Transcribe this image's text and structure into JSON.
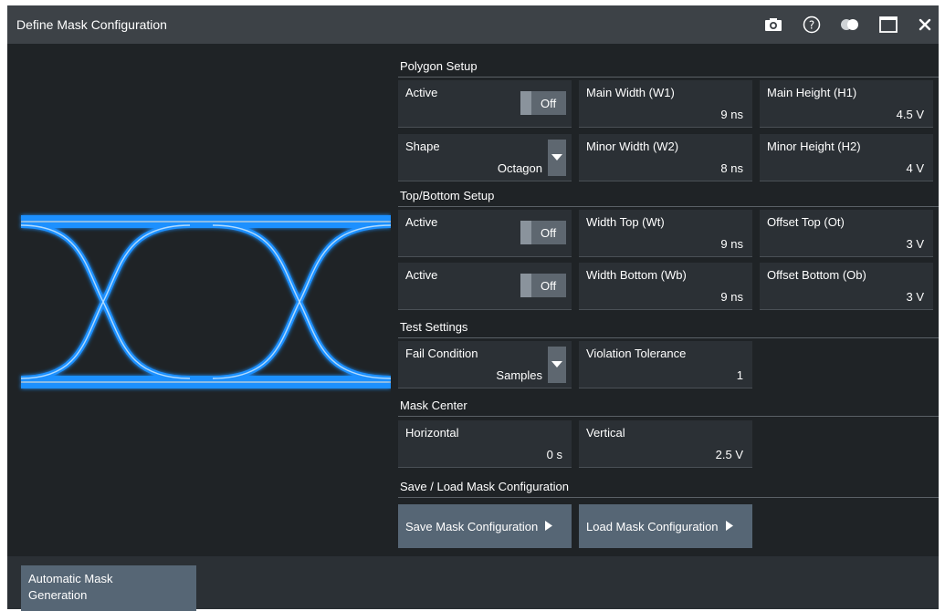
{
  "window": {
    "title": "Define Mask Configuration",
    "icons": [
      "camera-icon",
      "help-icon",
      "toggle-display-icon",
      "maximize-icon",
      "close-icon"
    ]
  },
  "polygon": {
    "header": "Polygon Setup",
    "active_label": "Active",
    "active_value": "Off",
    "main_width_label": "Main Width (W1)",
    "main_width_value": "9 ns",
    "main_height_label": "Main Height (H1)",
    "main_height_value": "4.5 V",
    "shape_label": "Shape",
    "shape_value": "Octagon",
    "minor_width_label": "Minor Width (W2)",
    "minor_width_value": "8 ns",
    "minor_height_label": "Minor Height (H2)",
    "minor_height_value": "4 V"
  },
  "topbottom": {
    "header": "Top/Bottom Setup",
    "top_active_label": "Active",
    "top_active_value": "Off",
    "width_top_label": "Width Top (Wt)",
    "width_top_value": "9 ns",
    "offset_top_label": "Offset Top (Ot)",
    "offset_top_value": "3 V",
    "bottom_active_label": "Active",
    "bottom_active_value": "Off",
    "width_bottom_label": "Width Bottom (Wb)",
    "width_bottom_value": "9 ns",
    "offset_bottom_label": "Offset Bottom (Ob)",
    "offset_bottom_value": "3 V"
  },
  "test": {
    "header": "Test Settings",
    "fail_label": "Fail Condition",
    "fail_value": "Samples",
    "tolerance_label": "Violation Tolerance",
    "tolerance_value": "1"
  },
  "center": {
    "header": "Mask Center",
    "horizontal_label": "Horizontal",
    "horizontal_value": "0 s",
    "vertical_label": "Vertical",
    "vertical_value": "2.5 V"
  },
  "saveload": {
    "header": "Save / Load Mask Configuration",
    "save_label": "Save Mask Configuration",
    "load_label": "Load Mask Configuration"
  },
  "bottom": {
    "auto_line1": "Automatic Mask",
    "auto_line2": "Generation"
  },
  "colors": {
    "window_bg": "#1f2326",
    "title_bg": "#3d4247",
    "field_bg": "#2b3035",
    "button_bg": "#566675",
    "eye_color": "#1e90ff"
  }
}
